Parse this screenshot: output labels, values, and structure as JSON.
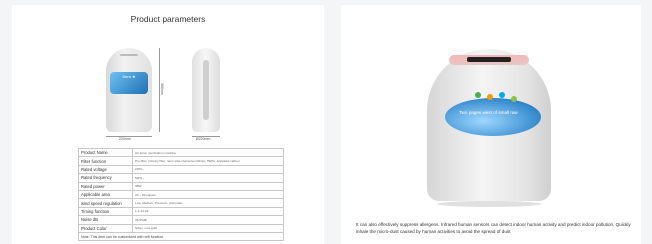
{
  "left": {
    "title": "Product parameters",
    "logo_text": "Sera ★",
    "dim_height": "360mm",
    "dim_width_front": "220mm",
    "dim_width_side": "Ø220mm",
    "specs": [
      {
        "label": "Product Name",
        "value": "Air anion sterilization machine"
      },
      {
        "label": "Filter function",
        "value": "Pre-filter, primary filter, nano silver bacteria inhibitor, HEPA, Activated carbon"
      },
      {
        "label": "Rated voltage",
        "value": "220V~"
      },
      {
        "label": "Rated frequency",
        "value": "50Hz~"
      },
      {
        "label": "Rated power",
        "value": "38W"
      },
      {
        "label": "Applicable area",
        "value": "20 ~ 60 square"
      },
      {
        "label": "wind speed regulation",
        "value": "Low, Medium, Premium, Automatic"
      },
      {
        "label": "Timing function",
        "value": "1-2-12-24"
      },
      {
        "label": "Noise dB",
        "value": "35-55dB"
      },
      {
        "label": "Product Color",
        "value": "Silver, rose gold"
      }
    ],
    "note": "Note: This item can be customized with wifi function"
  },
  "right": {
    "badge_caption": "Two pages west of small raw",
    "description": "It can also effectively suppress allergens. Infrared human sensors can detect indoor human activity and predict indoor pollution. Quickly inhale the micro-dust caused by human activities to avoid the spread of dust"
  },
  "colors": {
    "page_bg": "#f4f5f7",
    "accent_pink": "#f3b7b7",
    "badge_blue": "#2c83c9"
  }
}
